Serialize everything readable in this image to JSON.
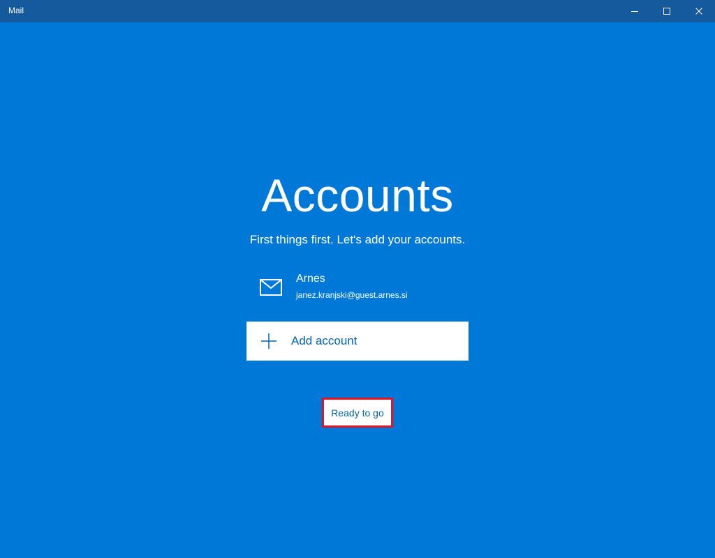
{
  "window": {
    "title": "Mail",
    "controls": {
      "minimize_icon": "minimize-icon",
      "maximize_icon": "maximize-icon",
      "close_icon": "close-icon"
    }
  },
  "accounts_page": {
    "heading": "Accounts",
    "subtitle": "First things first. Let's add your accounts.",
    "accounts": [
      {
        "name": "Arnes",
        "email": "janez.kranjski@guest.arnes.si",
        "icon": "mail-envelope-icon"
      }
    ],
    "add_account_label": "Add account",
    "add_account_icon": "plus-icon",
    "ready_label": "Ready to go"
  },
  "colors": {
    "background": "#0078d7",
    "titlebar": "#165a9e",
    "accent_text": "#0063b1",
    "highlight_border": "#e81123"
  }
}
